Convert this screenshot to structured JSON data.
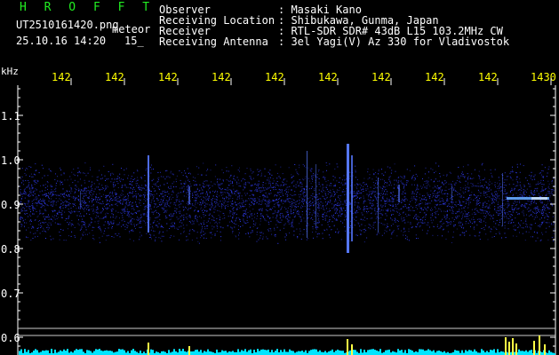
{
  "header": {
    "app_title": "H R O F F T",
    "filename": "UT2510161420.png",
    "detector_label": "meteor",
    "datetime": "25.10.16 14:20",
    "interval": "15_",
    "fields": [
      {
        "label": "Observer",
        "value": ": Masaki Kano"
      },
      {
        "label": "Receiving Location",
        "value": ": Shibukawa, Gunma, Japan"
      },
      {
        "label": "Receiver",
        "value": ": RTL-SDR SDR# 43dB L15 103.2MHz CW"
      },
      {
        "label": "Receiving Antenna",
        "value": ": 3el Yagi(V) Az 330 for Vladivostok"
      }
    ]
  },
  "axes": {
    "y_unit": "kHz",
    "y_ticks": [
      "1.1",
      "1.0",
      "0.9",
      "0.8",
      "0.7",
      "0.6"
    ],
    "x_ticks": [
      "142",
      "142",
      "142",
      "142",
      "142",
      "142",
      "142",
      "142",
      "142",
      "1430"
    ]
  },
  "colors": {
    "background": "#000000",
    "text": "#ffffff",
    "title": "#22ee22",
    "minute_labels": "#ffff00",
    "signal": "#3344ff",
    "meter": "#00e5ff"
  }
}
